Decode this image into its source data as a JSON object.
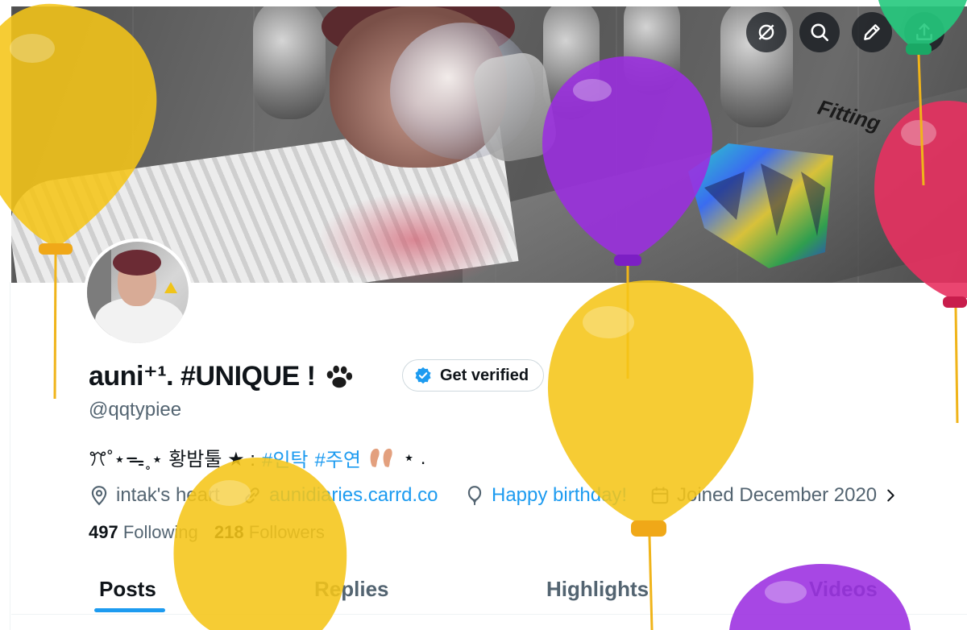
{
  "profile": {
    "display_name": "auni⁺¹. #UNIQUE !",
    "handle": "@qqtypiee",
    "verify_label": "Get verified",
    "bio_prefix": "ꔫ˚⋆ᯓ˳⋆ 황밤툴 ★ :",
    "bio_tags": [
      "#인탁",
      "#주연"
    ],
    "bio_suffix": "⋆ .",
    "location": "intak's heart",
    "website": "aunidiaries.carrd.co",
    "birthday": "Happy birthday!",
    "joined": "Joined December 2020",
    "following_count": "497",
    "following_label": "Following",
    "followers_count": "218",
    "followers_label": "Followers"
  },
  "banner": {
    "sign_text": "Fitting"
  },
  "top_controls": {
    "icons": [
      "no-sync-icon",
      "search-icon",
      "edit-icon",
      "share-icon"
    ]
  },
  "tabs": [
    {
      "label": "Posts",
      "active": true
    },
    {
      "label": "Replies",
      "active": false
    },
    {
      "label": "Highlights",
      "active": false
    },
    {
      "label": "Videos",
      "active": false
    }
  ],
  "colors": {
    "accent": "#1d9bf0",
    "text_primary": "#0f1419",
    "text_secondary": "#536471",
    "balloon_yellow": "#f5c518",
    "balloon_purple": "#9b2ee0",
    "balloon_pink": "#e83160",
    "balloon_green": "#25c97d"
  }
}
